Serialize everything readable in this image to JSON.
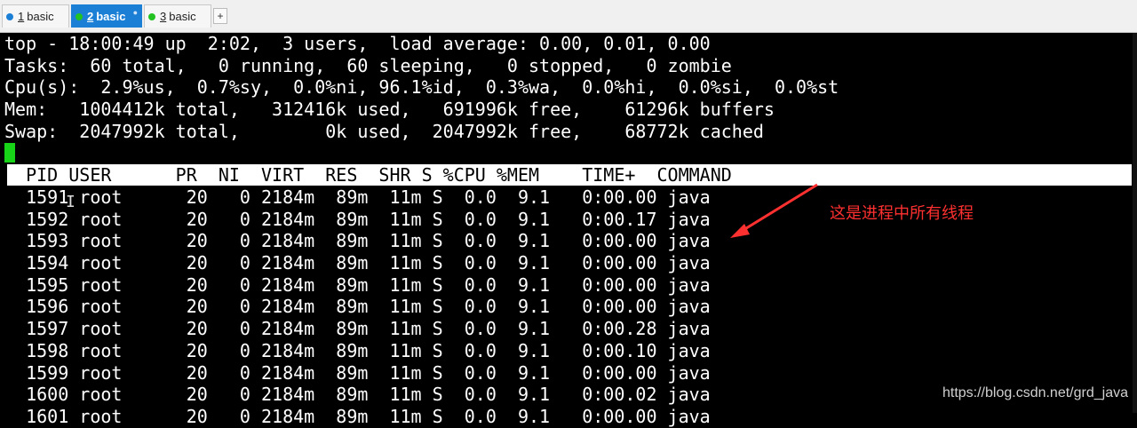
{
  "tabs": [
    {
      "num": "1",
      "label": "basic",
      "dot_color": "#1c7fd6",
      "active": false
    },
    {
      "num": "2",
      "label": "basic",
      "dot_color": "#21c221",
      "active": true
    },
    {
      "num": "3",
      "label": "basic",
      "dot_color": "#21c221",
      "active": false
    }
  ],
  "new_tab_label": "+",
  "summary": {
    "top": "top - 18:00:49 up  2:02,  3 users,  load average: 0.00, 0.01, 0.00",
    "tasks": "Tasks:  60 total,   0 running,  60 sleeping,   0 stopped,   0 zombie",
    "cpu": "Cpu(s):  2.9%us,  0.7%sy,  0.0%ni, 96.1%id,  0.3%wa,  0.0%hi,  0.0%si,  0.0%st",
    "mem": "Mem:   1004412k total,   312416k used,   691996k free,    61296k buffers",
    "swap": "Swap:  2047992k total,        0k used,  2047992k free,    68772k cached"
  },
  "table": {
    "header": "  PID USER      PR  NI  VIRT  RES  SHR S %CPU %MEM    TIME+  COMMAND",
    "rows": [
      "  1591 root      20   0 2184m  89m  11m S  0.0  9.1   0:00.00 java",
      "  1592 root      20   0 2184m  89m  11m S  0.0  9.1   0:00.17 java",
      "  1593 root      20   0 2184m  89m  11m S  0.0  9.1   0:00.00 java",
      "  1594 root      20   0 2184m  89m  11m S  0.0  9.1   0:00.00 java",
      "  1595 root      20   0 2184m  89m  11m S  0.0  9.1   0:00.00 java",
      "  1596 root      20   0 2184m  89m  11m S  0.0  9.1   0:00.00 java",
      "  1597 root      20   0 2184m  89m  11m S  0.0  9.1   0:00.28 java",
      "  1598 root      20   0 2184m  89m  11m S  0.0  9.1   0:00.10 java",
      "  1599 root      20   0 2184m  89m  11m S  0.0  9.1   0:00.00 java",
      "  1600 root      20   0 2184m  89m  11m S  0.0  9.1   0:00.02 java",
      "  1601 root      20   0 2184m  89m  11m S  0.0  9.1   0:00.00 java"
    ]
  },
  "annotation": {
    "text": "这是进程中所有线程",
    "color": "#ff3030"
  },
  "watermark": "https://blog.csdn.net/grd_java",
  "colors": {
    "cursor": "#18d418",
    "active_tab": "#1c7fd6"
  }
}
